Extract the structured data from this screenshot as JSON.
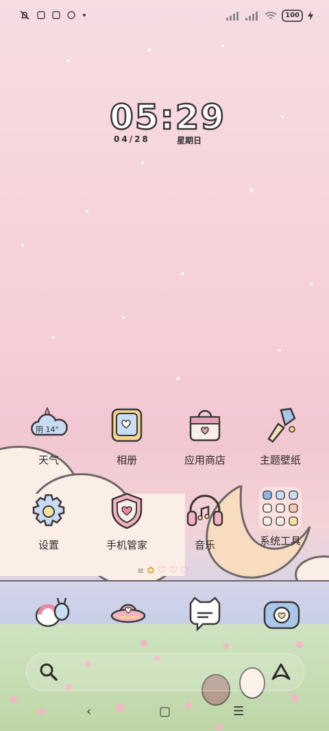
{
  "status_bar": {
    "battery_level": "100",
    "icons_left": [
      "bell-muted-icon",
      "notification-app-icon",
      "notification-app-icon",
      "notification-app-icon",
      "dot-icon"
    ],
    "icons_right": [
      "signal-icon",
      "signal-icon",
      "wifi-icon",
      "battery-icon",
      "charging-icon"
    ]
  },
  "clock": {
    "time": "05:29",
    "date": "04/28",
    "weekday": "星期日"
  },
  "apps_row1": [
    {
      "label": "天气",
      "icon": "weather-cloud-icon",
      "weather_text": "阴 14°"
    },
    {
      "label": "相册",
      "icon": "gallery-icon"
    },
    {
      "label": "应用商店",
      "icon": "app-store-bag-icon"
    },
    {
      "label": "主题壁纸",
      "icon": "paint-brush-icon"
    }
  ],
  "apps_row2": [
    {
      "label": "设置",
      "icon": "settings-gear-icon"
    },
    {
      "label": "手机管家",
      "icon": "shield-heart-icon"
    },
    {
      "label": "音乐",
      "icon": "headphones-icon"
    },
    {
      "label": "系统工具",
      "icon": "folder-grid-icon"
    }
  ],
  "page_indicator": {
    "pages": 4,
    "current": 1
  },
  "dock": [
    {
      "icon": "phone-bunny-icon"
    },
    {
      "icon": "browser-ufo-icon"
    },
    {
      "icon": "messages-cat-icon"
    },
    {
      "icon": "camera-icon"
    }
  ],
  "search_bar": {
    "icon_left": "search-icon",
    "icon_right": "ai-assistant-icon"
  },
  "nav_bar": {
    "back": "‹",
    "home": "▢",
    "menu": "☰"
  },
  "colors": {
    "outline": "#3b3636",
    "sky_pink": "#f6cfd8",
    "moon": "#f7dcc0",
    "grass": "#c9ddb8"
  }
}
